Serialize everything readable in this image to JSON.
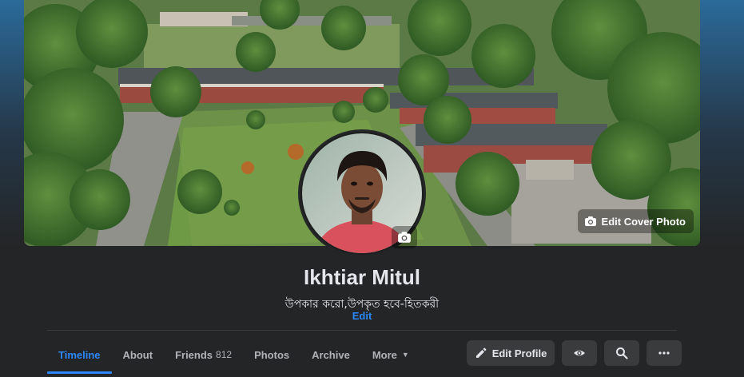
{
  "profile": {
    "name": "Ikhtiar Mitul",
    "bio": "উপকার করো,উপকৃত হবে-হিতকরী",
    "bio_edit_label": "Edit"
  },
  "cover": {
    "edit_cover_label": "Edit Cover Photo",
    "icon": "camera-icon"
  },
  "avatar": {
    "camera_icon": "camera-icon"
  },
  "tabs": [
    {
      "label": "Timeline",
      "active": true
    },
    {
      "label": "About"
    },
    {
      "label": "Friends",
      "count": "812"
    },
    {
      "label": "Photos"
    },
    {
      "label": "Archive"
    },
    {
      "label": "More",
      "icon": "caret-down-icon"
    }
  ],
  "actions": {
    "edit_profile_label": "Edit Profile",
    "edit_profile_icon": "pencil-icon",
    "view_as_icon": "eye-icon",
    "search_icon": "search-icon",
    "more_icon": "ellipsis-icon"
  },
  "colors": {
    "background": "#242526",
    "accent": "#2d88ff",
    "button_bg": "#3a3b3c",
    "text_primary": "#e4e6eb",
    "text_secondary": "#b0b3b8"
  }
}
